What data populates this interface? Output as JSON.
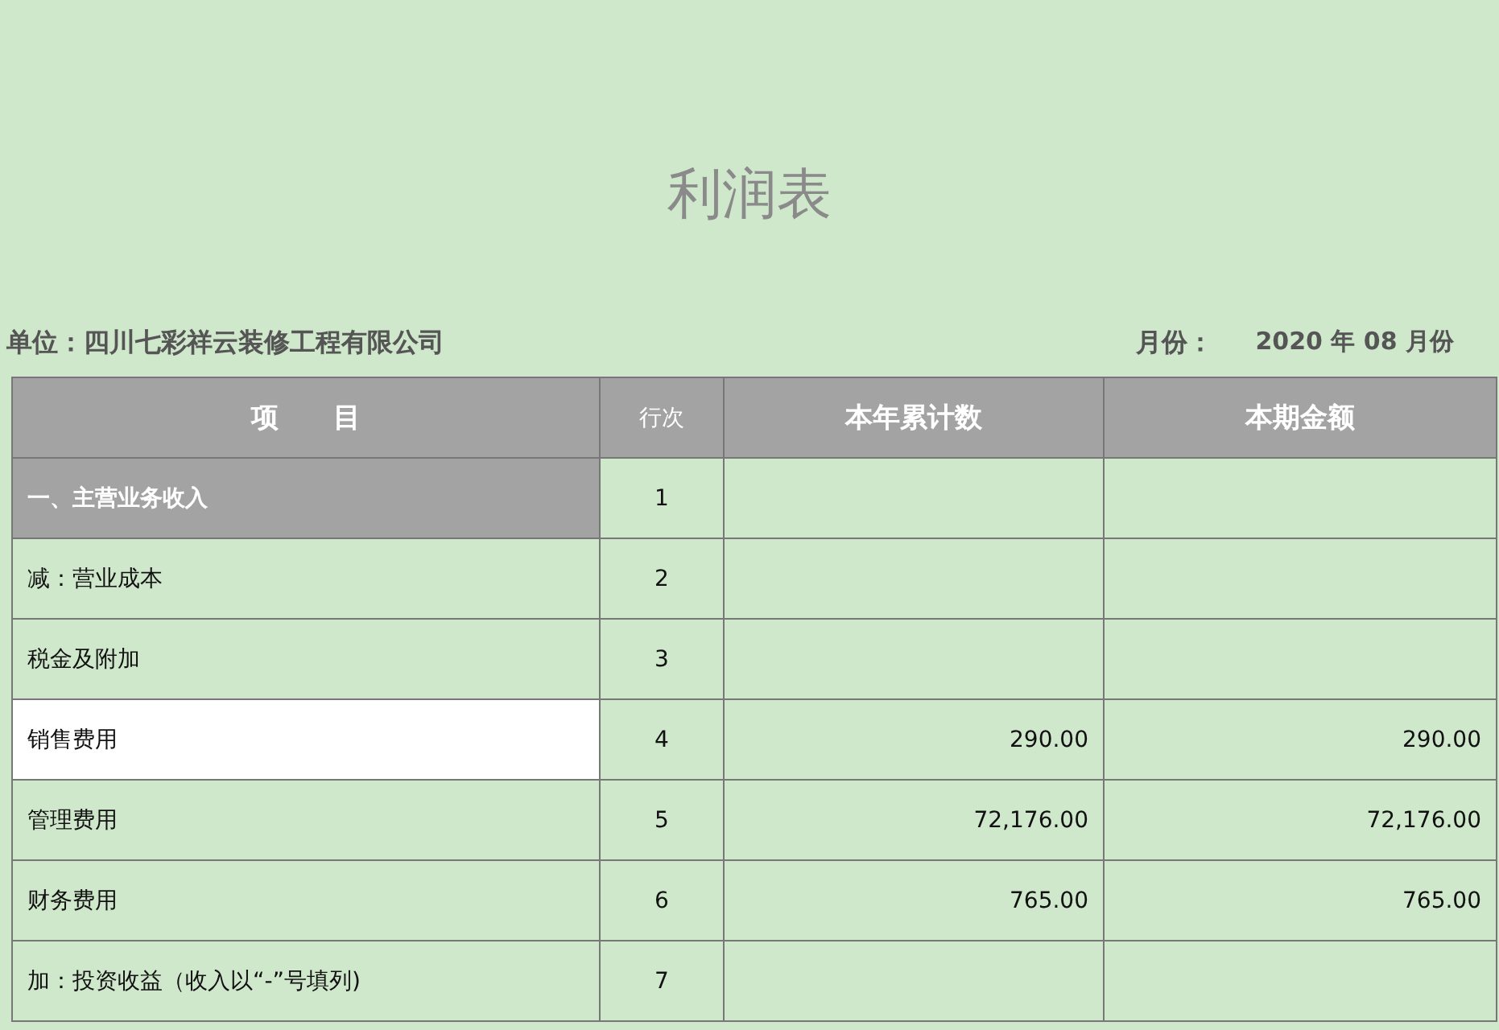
{
  "title": "利润表",
  "unit": {
    "label": "单位：",
    "value": "四川七彩祥云装修工程有限公司"
  },
  "period": {
    "label": "月份：",
    "value": "2020 年 08 月份"
  },
  "table": {
    "columns": [
      "项　　目",
      "行次",
      "本年累计数",
      "本期金额"
    ],
    "rows": [
      {
        "kind": "section",
        "item": "一、主营业务收入",
        "line": "1",
        "year_total": "",
        "period_amount": "",
        "selected": false
      },
      {
        "kind": "item",
        "item": "减：营业成本",
        "line": "2",
        "year_total": "",
        "period_amount": "",
        "selected": false
      },
      {
        "kind": "item",
        "item": "税金及附加",
        "line": "3",
        "year_total": "",
        "period_amount": "",
        "selected": false
      },
      {
        "kind": "item",
        "item": "销售费用",
        "line": "4",
        "year_total": "290.00",
        "period_amount": "290.00",
        "selected": true
      },
      {
        "kind": "item",
        "item": "管理费用",
        "line": "5",
        "year_total": "72,176.00",
        "period_amount": "72,176.00",
        "selected": false
      },
      {
        "kind": "item",
        "item": "财务费用",
        "line": "6",
        "year_total": "765.00",
        "period_amount": "765.00",
        "selected": false
      },
      {
        "kind": "item",
        "item": "加：投资收益（收入以“-”号填列)",
        "line": "7",
        "year_total": "",
        "period_amount": "",
        "selected": false
      }
    ]
  }
}
